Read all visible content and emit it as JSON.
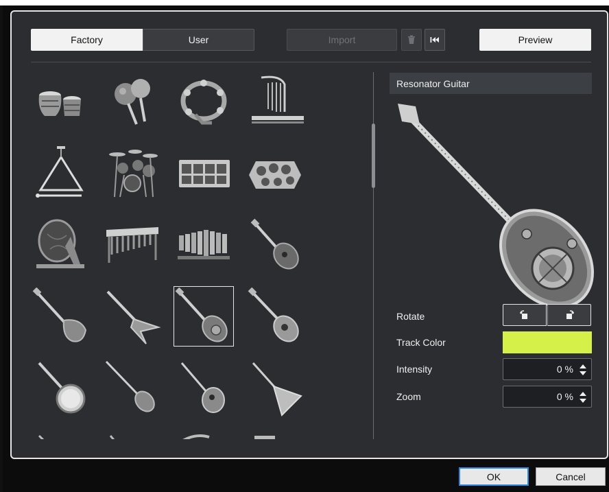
{
  "tabs": {
    "factory": "Factory",
    "user": "User"
  },
  "toolbar": {
    "import": "Import",
    "preview": "Preview",
    "trash_icon": "trash-icon",
    "first_icon": "skip-to-start-icon"
  },
  "grid": {
    "selected": "resonator-guitar",
    "items": [
      "tabla",
      "maracas",
      "tambourine",
      "harp",
      "triangle",
      "drum-kit",
      "drum-pad",
      "electronic-pads",
      "gong",
      "marimba",
      "xylophone",
      "archtop-guitar",
      "electric-bass",
      "flying-v-guitar",
      "resonator-guitar",
      "acoustic-guitar",
      "banjo",
      "bouzouki",
      "mandolin",
      "balalaika",
      "partial-1",
      "partial-2",
      "partial-3",
      "partial-4"
    ]
  },
  "detail": {
    "name": "Resonator Guitar",
    "rotate_label": "Rotate",
    "track_color_label": "Track Color",
    "track_color": "#d6f04a",
    "intensity_label": "Intensity",
    "intensity_value": "0 %",
    "zoom_label": "Zoom",
    "zoom_value": "0 %"
  },
  "footer": {
    "ok": "OK",
    "cancel": "Cancel"
  }
}
